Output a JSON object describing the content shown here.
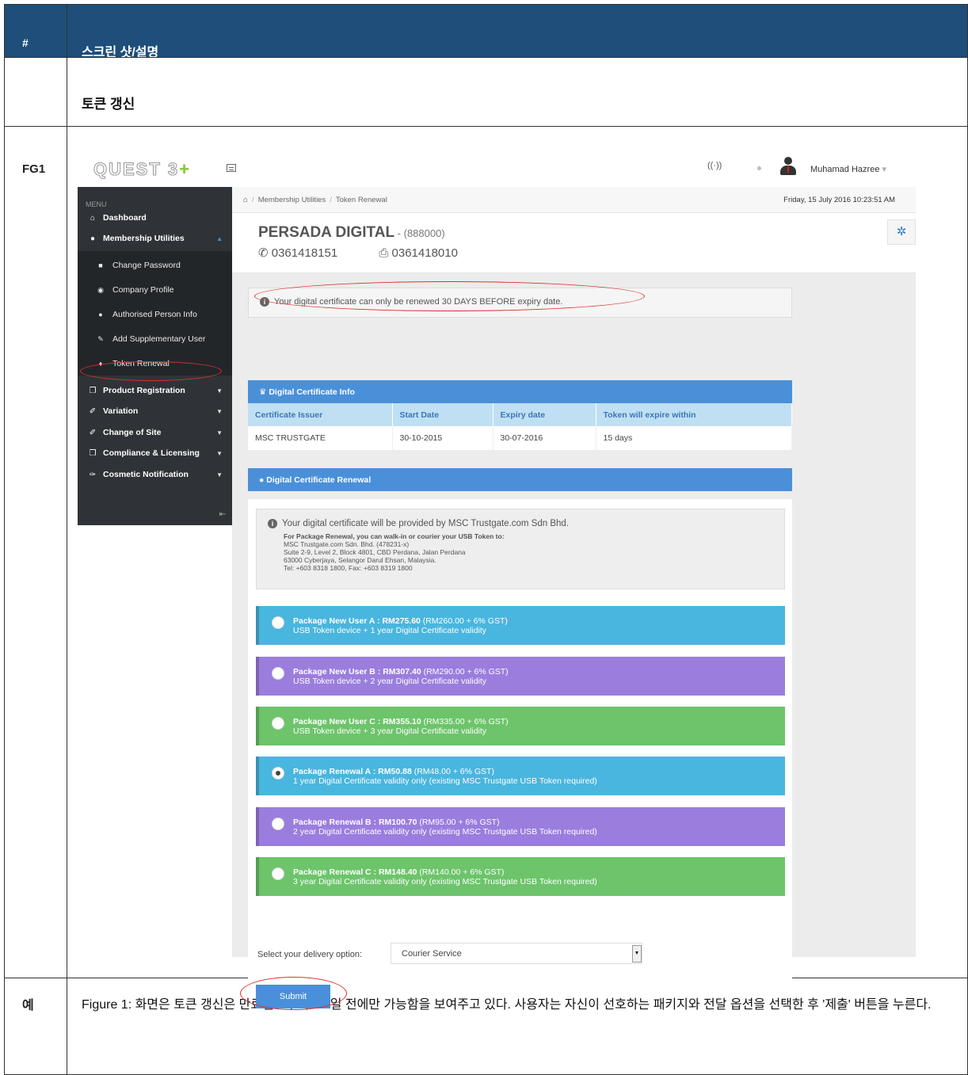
{
  "doc": {
    "header_num": "#",
    "header_title": "스크린 샷/설명",
    "section_title": "토큰 갱신",
    "fig_label": "FG1",
    "example_label": "예",
    "description": "Figure 1: 화면은 토큰 갱신은 만료일로부터 30 일 전에만 가능함을 보여주고 있다. 사용자는 자신이 선호하는 패키지와 전달 옵션을 선택한 후 '제출' 버튼을 누른다."
  },
  "app": {
    "logo": "QUEST 3",
    "logo_plus": "+",
    "user_name": "Muhamad Hazree",
    "menu_caption": "MENU",
    "nav": {
      "dashboard": "Dashboard",
      "membership": "Membership Utilities",
      "change_password": "Change Password",
      "company_profile": "Company Profile",
      "authorised_person": "Authorised Person Info",
      "add_supplementary": "Add Supplementary User",
      "token_renewal": "Token Renewal",
      "product_registration": "Product Registration",
      "variation": "Variation",
      "change_of_site": "Change of Site",
      "compliance": "Compliance & Licensing",
      "cosmetic": "Cosmetic Notification"
    },
    "breadcrumb": [
      "Membership Utilities",
      "Token Renewal"
    ],
    "datetime": "Friday, 15 July 2016 10:23:51 AM",
    "company": {
      "name": "PERSADA DIGITAL",
      "code": " - (888000)",
      "phone": "0361418151",
      "fax": "0361418010"
    },
    "alert_text": "Your digital certificate can only be renewed 30 DAYS BEFORE expiry date.",
    "cert_info": {
      "title": "Digital Certificate Info",
      "columns": [
        "Certificate Issuer",
        "Start Date",
        "Expiry date",
        "Token will expire within"
      ],
      "row": [
        "MSC TRUSTGATE",
        "30-10-2015",
        "30-07-2016",
        "15 days"
      ]
    },
    "renewal": {
      "title": "Digital Certificate Renewal",
      "info_main": "Your digital certificate will be provided by MSC Trustgate.com Sdn Bhd.",
      "info_heading": "For Package Renewal, you can walk-in or courier your USB Token to:",
      "address": [
        "MSC Trustgate.com Sdn. Bhd. (478231-x)",
        "Suite 2-9, Level 2, Block 4801, CBD Perdana, Jalan Perdana",
        "63000 Cyberjaya, Selangor Darul Ehsan, Malaysia.",
        "Tel: +603 8318 1800, Fax: +603 8319 1800"
      ],
      "packages": [
        {
          "name": "Package New User A : RM275.60",
          "price": " (RM260.00 + 6% GST)",
          "desc": "USB Token device + 1 year Digital Certificate validity",
          "color": "#49b6df",
          "selected": false
        },
        {
          "name": "Package New User B : RM307.40",
          "price": " (RM290.00 + 6% GST)",
          "desc": "USB Token device + 2 year Digital Certificate validity",
          "color": "#9b7dde",
          "selected": false
        },
        {
          "name": "Package New User C : RM355.10",
          "price": " (RM335.00 + 6% GST)",
          "desc": "USB Token device + 3 year Digital Certificate validity",
          "color": "#6dc46b",
          "selected": false
        },
        {
          "name": "Package Renewal A : RM50.88",
          "price": " (RM48.00 + 6% GST)",
          "desc": "1 year Digital Certificate validity only (existing MSC Trustgate USB Token required)",
          "color": "#49b6df",
          "selected": true
        },
        {
          "name": "Package Renewal B : RM100.70",
          "price": " (RM95.00 + 6% GST)",
          "desc": "2 year Digital Certificate validity only (existing MSC Trustgate USB Token required)",
          "color": "#9b7dde",
          "selected": false
        },
        {
          "name": "Package Renewal C : RM148.40",
          "price": " (RM140.00 + 6% GST)",
          "desc": "3 year Digital Certificate validity only (existing MSC Trustgate USB Token required)",
          "color": "#6dc46b",
          "selected": false
        }
      ],
      "delivery_label": "Select your delivery option:",
      "delivery_value": "Courier Service",
      "submit_label": "Submit"
    }
  }
}
